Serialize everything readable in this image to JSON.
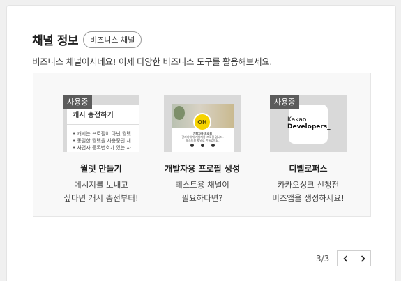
{
  "header": {
    "title": "채널 정보",
    "badge": "비즈니스 채널"
  },
  "description": "비즈니스 채널이시네요! 이제 다양한 비즈니스 도구를 활용해보세요.",
  "cards": [
    {
      "in_use_label": "사용중",
      "thumb_heading": "캐시 충전하기",
      "thumb_lines": [
        "• 캐시는 프로필이 아닌 월렛",
        "• 동일한 월렛을 사용중인 채",
        "• 사업자 등록번호가 있는 사"
      ],
      "title": "월렛 만들기",
      "desc_line1": "메시지를 보내고",
      "desc_line2": "싶다면 캐시 충전부터!"
    },
    {
      "thumb_avatar": "OH",
      "thumb_name": "개발자용 프로필",
      "thumb_text1": "관리자에게 개발자용 프로필 입니다.",
      "thumb_text2": "테스트용 채널로 만들었어요.",
      "title": "개발자용 프로필 생성",
      "desc_line1": "테스트용 채널이",
      "desc_line2": "필요하다면?"
    },
    {
      "in_use_label": "사용중",
      "logo_line1": "Kakao",
      "logo_line2": "Developers_",
      "title": "디벨로퍼스",
      "desc_line1": "카카오싱크 신청전",
      "desc_line2": "비즈앱을 생성하세요!"
    }
  ],
  "pagination": {
    "label": "3/3",
    "prev_icon": "chevron-left-icon",
    "next_icon": "chevron-right-icon"
  },
  "colors": {
    "badge_bg": "#5c5c5c",
    "kakao_yellow": "#f6d300",
    "panel_bg": "#f8f8f8"
  }
}
